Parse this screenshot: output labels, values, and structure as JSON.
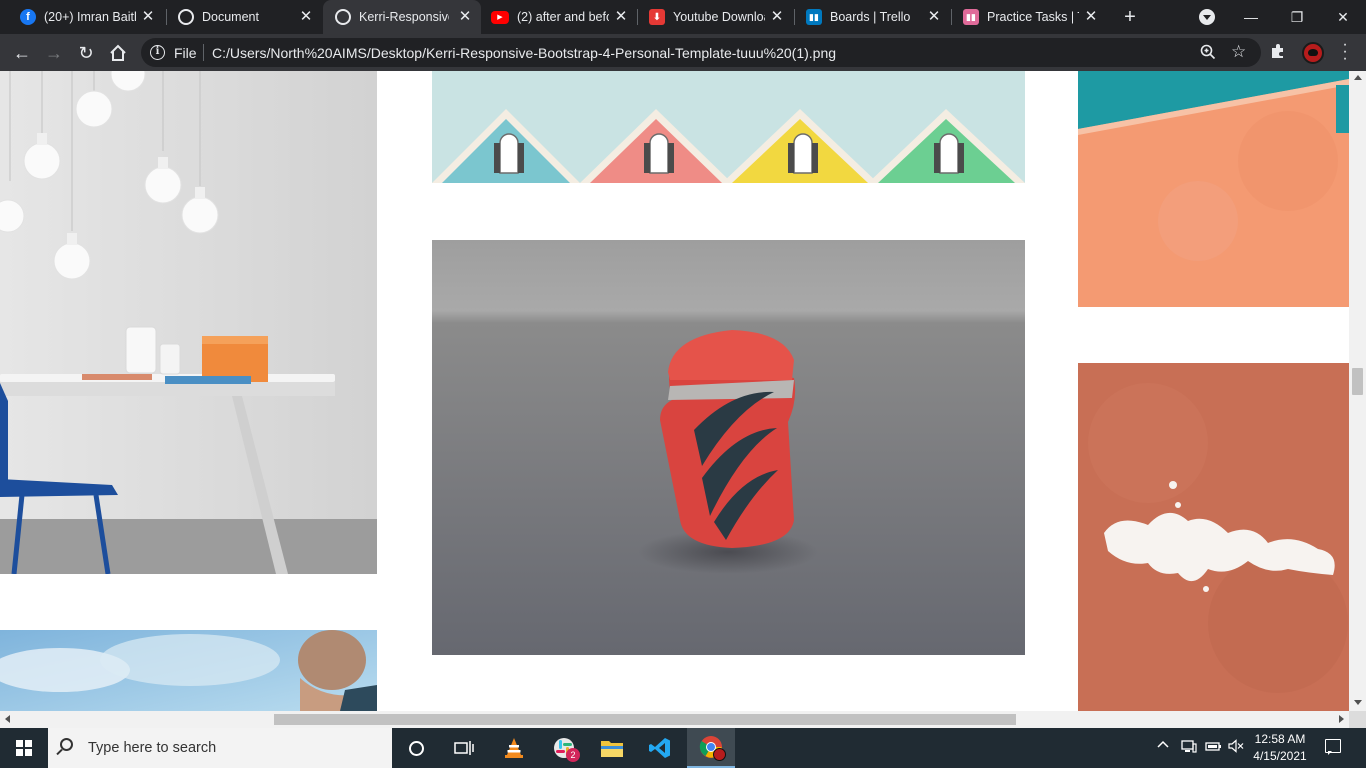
{
  "browser": {
    "tabs": [
      {
        "title": "(20+) Imran Baith",
        "favicon": "facebook-icon",
        "color": "#1877f2",
        "active": false
      },
      {
        "title": "Document",
        "favicon": "globe-icon",
        "color": "#e8eaed",
        "active": false
      },
      {
        "title": "Kerri-Responsive-",
        "favicon": "globe-icon",
        "color": "#e8eaed",
        "active": true
      },
      {
        "title": "(2) after and befo",
        "favicon": "youtube-icon",
        "color": "#ff0000",
        "active": false
      },
      {
        "title": "Youtube Downloa",
        "favicon": "download-icon",
        "color": "#e53935",
        "active": false
      },
      {
        "title": "Boards | Trello",
        "favicon": "trello-icon",
        "color": "#0079bf",
        "active": false
      },
      {
        "title": "Practice Tasks | Tr",
        "favicon": "trello-icon",
        "color": "#0079bf",
        "active": false
      }
    ],
    "new_tab_label": "+",
    "window_controls": {
      "minimize": "—",
      "maximize": "❐",
      "close": "✕"
    },
    "omnibox": {
      "scheme_label": "File",
      "url": "C:/Users/North%20AIMS/Desktop/Kerri-Responsive-Bootstrap-4-Personal-Template-tuuu%20(1).png"
    }
  },
  "page": {
    "images": [
      {
        "name": "hanging-bulbs-desk-photo",
        "description": "pendant light bulbs over white desk and blue chair"
      },
      {
        "name": "colorful-rooftops-photo",
        "description": "four pastel house rooftops"
      },
      {
        "name": "orange-wall-photo",
        "description": "orange stucco wall with teal roof edge"
      },
      {
        "name": "red-lighter-photo",
        "description": "red lighter on grey surface"
      },
      {
        "name": "terracotta-wall-photo",
        "description": "terracotta wall with peeling white paint"
      },
      {
        "name": "sky-portrait-photo",
        "description": "man looking down against blue sky"
      }
    ]
  },
  "taskbar": {
    "search_placeholder": "Type here to search",
    "pinned": [
      {
        "name": "cortana-icon"
      },
      {
        "name": "task-view-icon"
      },
      {
        "name": "vlc-icon"
      },
      {
        "name": "slack-icon",
        "badge": "2"
      },
      {
        "name": "file-explorer-icon"
      },
      {
        "name": "vscode-icon"
      },
      {
        "name": "chrome-icon",
        "active": true
      }
    ],
    "clock": {
      "time": "12:58 AM",
      "date": "4/15/2021"
    }
  }
}
